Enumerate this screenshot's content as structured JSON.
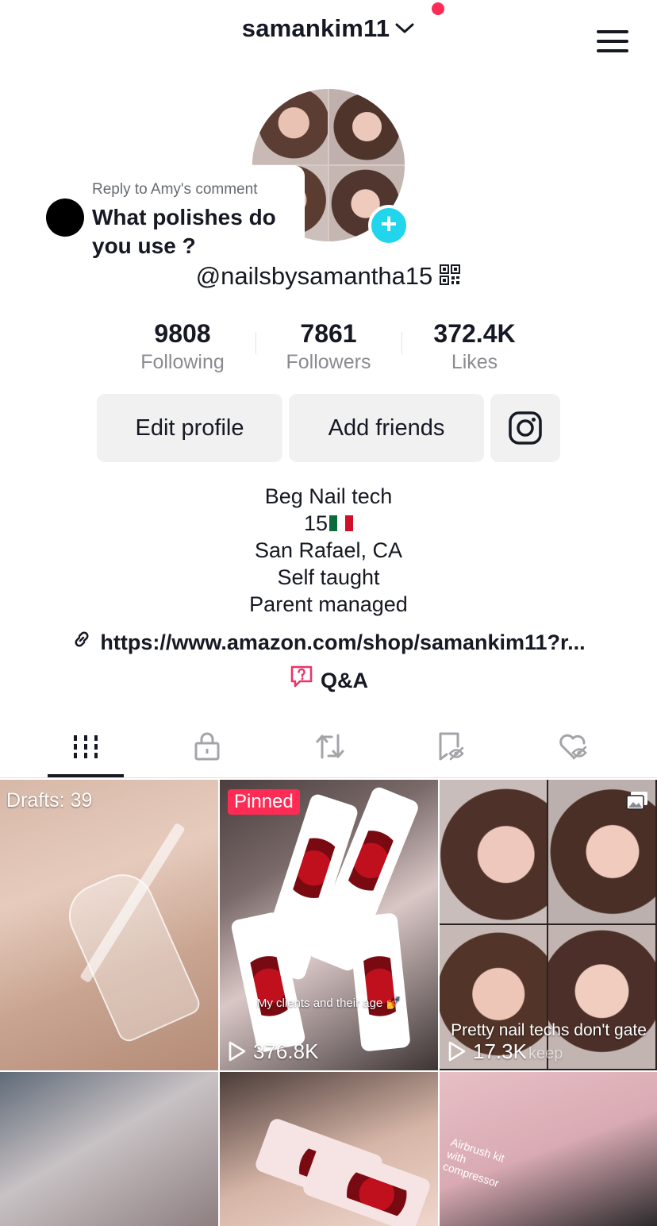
{
  "header": {
    "username": "samankim11",
    "chevron_icon": "chevron-down-icon",
    "menu_icon": "hamburger-menu-icon",
    "notification_color": "#fe2c55"
  },
  "reply_overlay": {
    "label": "Reply to Amy's comment",
    "text": "What polishes do you use ?"
  },
  "profile": {
    "handle": "@nailsbysamantha15",
    "qr_icon": "qr-code-icon",
    "add_icon": "plus-icon",
    "add_color": "#20d5ec"
  },
  "stats": [
    {
      "value": "9808",
      "label": "Following"
    },
    {
      "value": "7861",
      "label": "Followers"
    },
    {
      "value": "372.4K",
      "label": "Likes"
    }
  ],
  "actions": {
    "edit_profile": "Edit profile",
    "add_friends": "Add friends",
    "instagram_icon": "instagram-icon"
  },
  "bio": {
    "line1": "Beg Nail tech",
    "line2": "15",
    "line2_flag": "mexico-flag",
    "line3": "San Rafael, CA",
    "line4": "Self taught",
    "line5": "Parent managed"
  },
  "link": {
    "icon": "link-icon",
    "text": "https://www.amazon.com/shop/samankim11?r..."
  },
  "qa": {
    "icon": "qa-icon",
    "label": "Q&A",
    "accent": "#e8366b"
  },
  "tabs": [
    {
      "icon": "videos-grid-icon",
      "active": true
    },
    {
      "icon": "lock-icon",
      "active": false
    },
    {
      "icon": "repost-icon",
      "active": false
    },
    {
      "icon": "favorites-hidden-icon",
      "active": false
    },
    {
      "icon": "liked-hidden-icon",
      "active": false
    }
  ],
  "grid": {
    "drafts": "Drafts: 39",
    "pinned": "Pinned",
    "video2_caption": "My clients and their age 💅",
    "video2_views": "376.8K",
    "video3_caption": "Pretty nail techs don't gate",
    "video3_views": "17.3K",
    "video3_overlay": "keep",
    "video6_text1": "Airbrush kit",
    "video6_text2": "with",
    "video6_text3": "compressor",
    "photo_icon": "photo-carousel-icon",
    "play_icon": "play-icon"
  }
}
